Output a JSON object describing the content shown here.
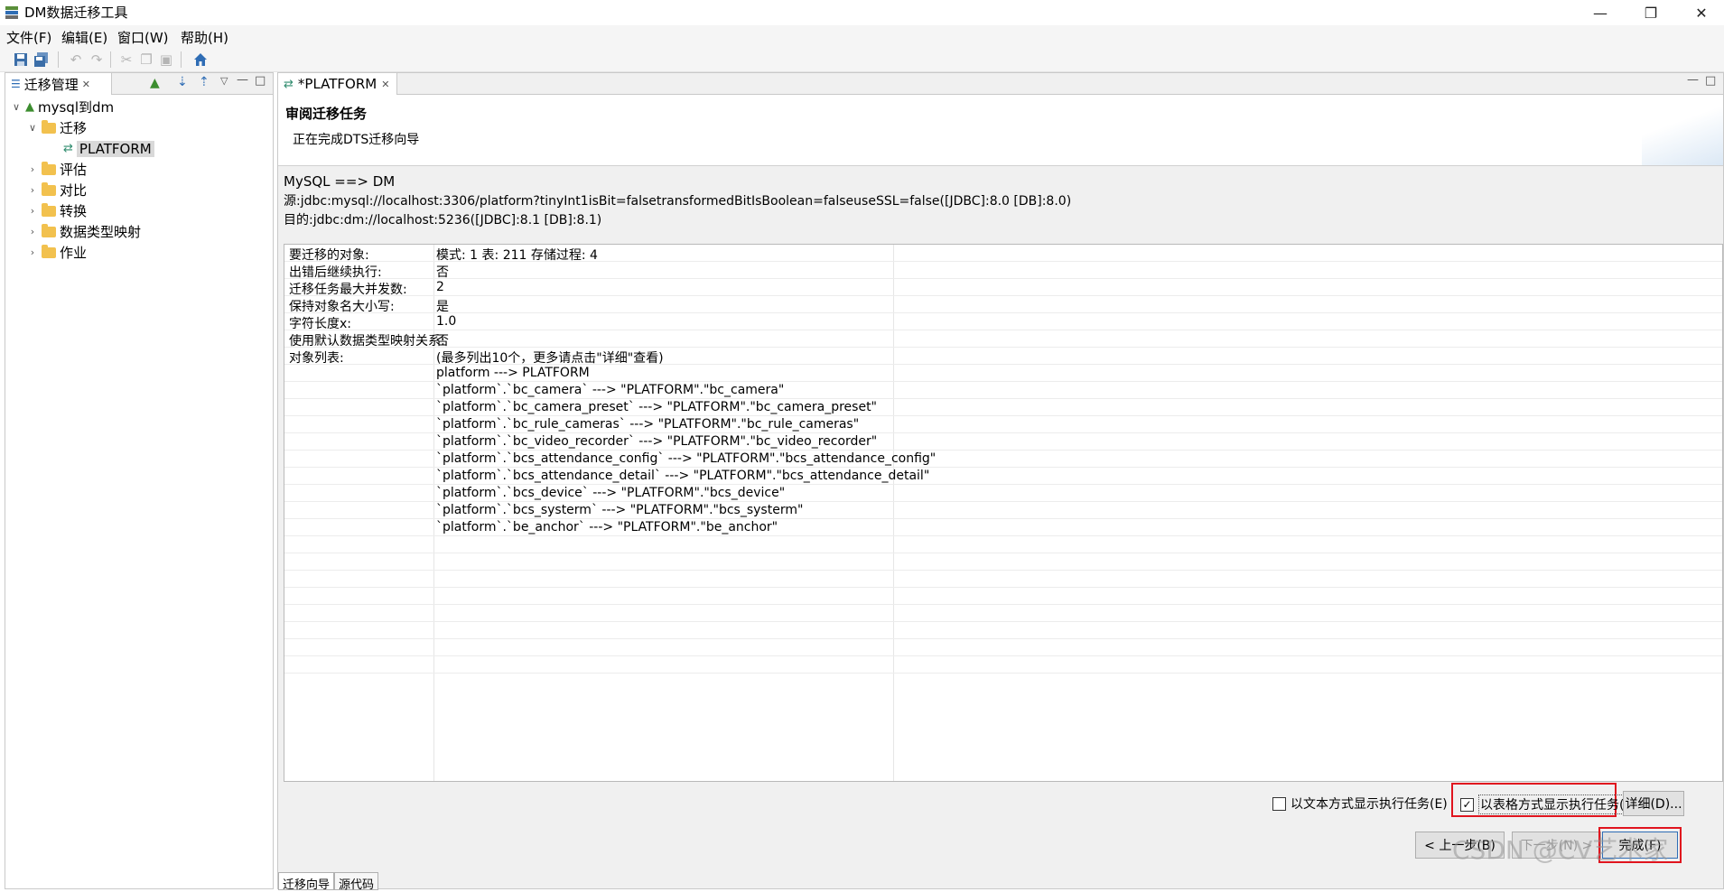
{
  "window": {
    "title": "DM数据迁移工具"
  },
  "menu": [
    "文件(F)",
    "编辑(E)",
    "窗口(W)",
    "帮助(H)"
  ],
  "left_panel": {
    "tab_label": "迁移管理",
    "tree": {
      "root": "mysql到dm",
      "migration_folder": "迁移",
      "migration_item": "PLATFORM",
      "folders": [
        "评估",
        "对比",
        "转换",
        "数据类型映射",
        "作业"
      ]
    }
  },
  "editor": {
    "tab_label": "*PLATFORM",
    "wizard_title": "审阅迁移任务",
    "wizard_desc": "正在完成DTS迁移向导",
    "info": {
      "line1": "MySQL ==> DM",
      "line2": "源:jdbc:mysql://localhost:3306/platform?tinyInt1isBit=falsetransformedBitIsBoolean=falseuseSSL=false([JDBC]:8.0 [DB]:8.0)",
      "line3": "目的:jdbc:dm://localhost:5236([JDBC]:8.1 [DB]:8.1)"
    },
    "rows": [
      {
        "key": "要迁移的对象:",
        "value": "模式: 1 表: 211 存储过程: 4"
      },
      {
        "key": "出错后继续执行:",
        "value": "否"
      },
      {
        "key": "迁移任务最大并发数:",
        "value": "2"
      },
      {
        "key": "保持对象名大小写:",
        "value": "是"
      },
      {
        "key": "字符长度x:",
        "value": "1.0"
      },
      {
        "key": "使用默认数据类型映射关系:",
        "value": "否"
      },
      {
        "key": "对象列表:",
        "value": "(最多列出10个，更多请点击\"详细\"查看)"
      },
      {
        "key": "",
        "value": "platform ---> PLATFORM"
      },
      {
        "key": "",
        "value": "`platform`.`bc_camera` ---> \"PLATFORM\".\"bc_camera\""
      },
      {
        "key": "",
        "value": "`platform`.`bc_camera_preset` ---> \"PLATFORM\".\"bc_camera_preset\""
      },
      {
        "key": "",
        "value": "`platform`.`bc_rule_cameras` ---> \"PLATFORM\".\"bc_rule_cameras\""
      },
      {
        "key": "",
        "value": "`platform`.`bc_video_recorder` ---> \"PLATFORM\".\"bc_video_recorder\""
      },
      {
        "key": "",
        "value": "`platform`.`bcs_attendance_config` ---> \"PLATFORM\".\"bcs_attendance_config\""
      },
      {
        "key": "",
        "value": "`platform`.`bcs_attendance_detail` ---> \"PLATFORM\".\"bcs_attendance_detail\""
      },
      {
        "key": "",
        "value": "`platform`.`bcs_device` ---> \"PLATFORM\".\"bcs_device\""
      },
      {
        "key": "",
        "value": "`platform`.`bcs_systerm` ---> \"PLATFORM\".\"bcs_systerm\""
      },
      {
        "key": "",
        "value": "`platform`.`be_anchor` ---> \"PLATFORM\".\"be_anchor\""
      }
    ],
    "options": {
      "text_mode_label": "以文本方式显示执行任务(E)",
      "text_mode_checked": false,
      "table_mode_label": "以表格方式显示执行任务(Z)",
      "table_mode_checked": true,
      "detail_button": "详细(D)..."
    },
    "buttons": {
      "back": "< 上一步(B)",
      "next": "下一步(N) >",
      "finish": "完成(F)"
    },
    "bottom_tabs": [
      "迁移向导",
      "源代码"
    ]
  },
  "watermark": "CSDN @CV艺术家",
  "colors": {
    "highlight_border": "#e0141e",
    "selection": "#d9d9d9",
    "folder": "#f2c14e"
  }
}
